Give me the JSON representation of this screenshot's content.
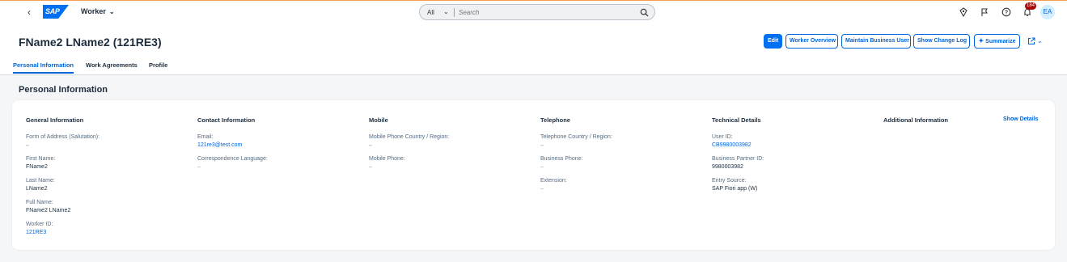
{
  "shell": {
    "app_title": "Worker",
    "search_scope": "All",
    "search_placeholder": "Search",
    "notification_count": "184",
    "avatar_initials": "EA",
    "logo_text": "SAP"
  },
  "header": {
    "title": "FName2 LName2 (121RE3)",
    "buttons": {
      "edit": "Edit",
      "worker_overview": "Worker Overview",
      "maintain_business_user": "Maintain Business User",
      "show_change_log": "Show Change Log",
      "summarize": "Summarize"
    },
    "tabs": [
      "Personal Information",
      "Work Agreements",
      "Profile"
    ]
  },
  "section": {
    "title": "Personal Information",
    "show_details": "Show Details",
    "columns": [
      {
        "heading": "General Information",
        "fields": [
          {
            "label": "Form of Address (Salutation):",
            "value": "–"
          },
          {
            "label": "First Name:",
            "value": "FName2"
          },
          {
            "label": "Last Name:",
            "value": "LName2"
          },
          {
            "label": "Full Name:",
            "value": "FName2 LName2"
          },
          {
            "label": "Worker ID:",
            "value": "121RE3"
          }
        ]
      },
      {
        "heading": "Contact Information",
        "fields": [
          {
            "label": "Email:",
            "value": "121re3@test.com"
          },
          {
            "label": "Correspondence Language:",
            "value": "–"
          }
        ]
      },
      {
        "heading": "Mobile",
        "fields": [
          {
            "label": "Mobile Phone Country / Region:",
            "value": "–"
          },
          {
            "label": "Mobile Phone:",
            "value": "–"
          }
        ]
      },
      {
        "heading": "Telephone",
        "fields": [
          {
            "label": "Telephone Country / Region:",
            "value": "–"
          },
          {
            "label": "Business Phone:",
            "value": "–"
          },
          {
            "label": "Extension:",
            "value": "–"
          }
        ]
      },
      {
        "heading": "Technical Details",
        "fields": [
          {
            "label": "User ID:",
            "value": "CB9980003982"
          },
          {
            "label": "Business Partner ID:",
            "value": "9980003982"
          },
          {
            "label": "Entry Source:",
            "value": "SAP Fiori app (W)"
          }
        ]
      },
      {
        "heading": "Additional Information",
        "fields": []
      }
    ]
  },
  "colors": {
    "brand": "#0070f2",
    "link": "#0064d9",
    "badge": "#aa0808"
  }
}
